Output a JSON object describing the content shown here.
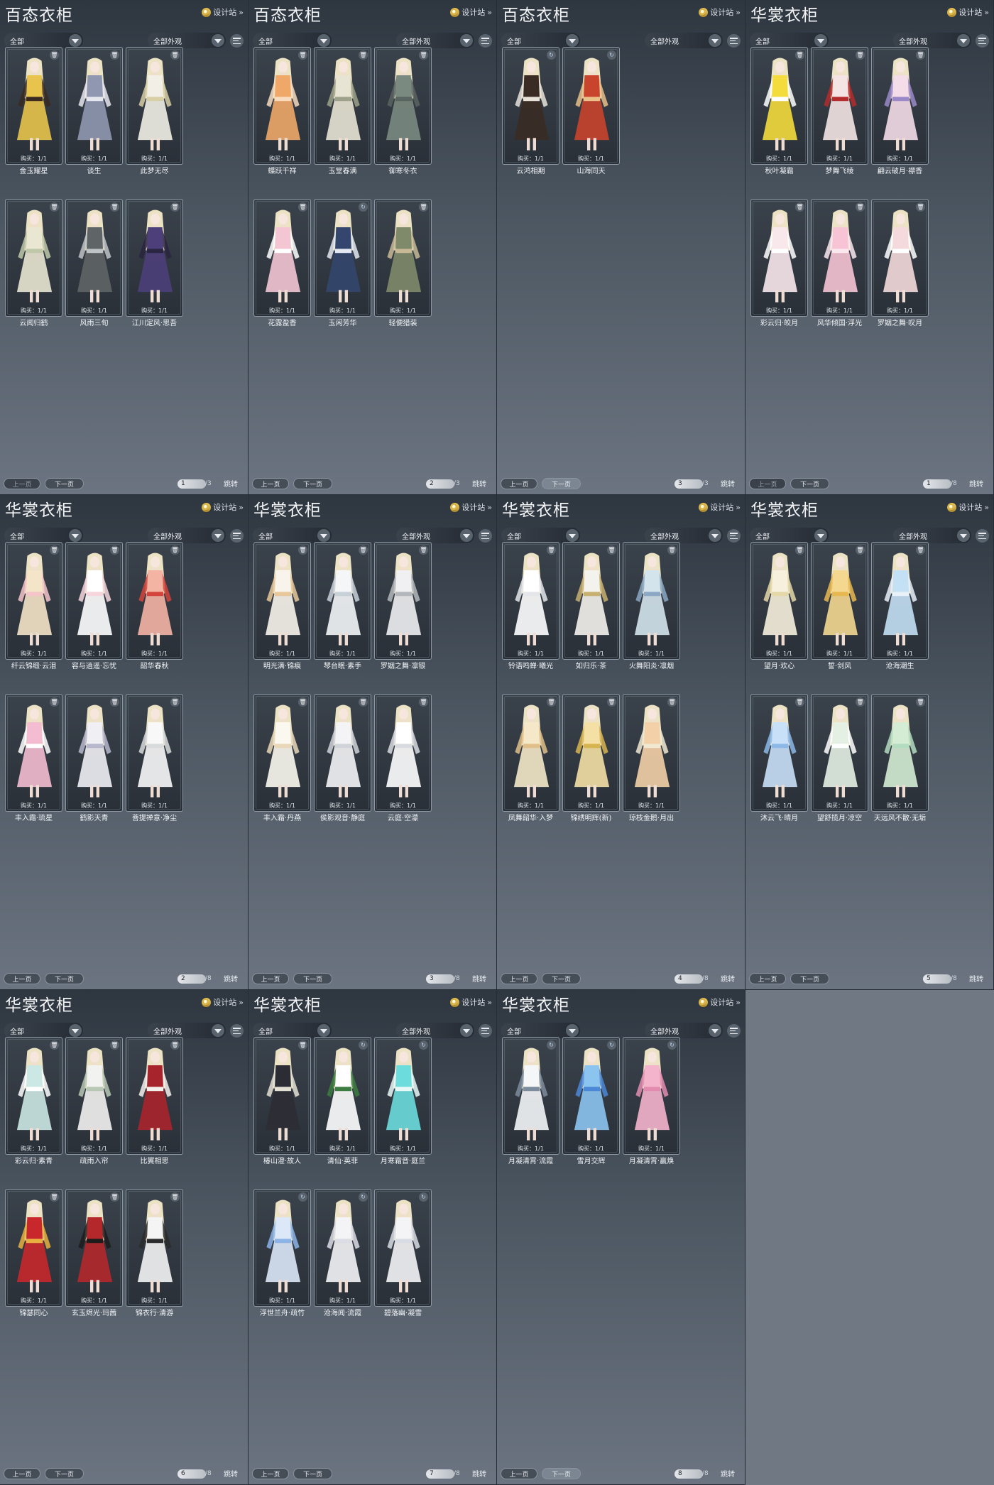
{
  "common": {
    "design_label": "设计站",
    "filter_left": "全部",
    "filter_right": "全部外观",
    "owned_label": "购买：1/1",
    "prev_label": "上一页",
    "next_label": "下一页",
    "jump_label": "跳转",
    "colors": {
      "panel_top": "#2e3640",
      "panel_bottom": "#6b7480",
      "card_border": "#8c98a4",
      "background": "#6f7883"
    }
  },
  "panels": [
    {
      "title": "百态衣柜",
      "page": "1",
      "total": "/3",
      "items": [
        {
          "name": "金玉耀星",
          "icon": "trash-icon",
          "palette": [
            "#e8c44c",
            "#3a2a22"
          ]
        },
        {
          "name": "谈生",
          "icon": "trash-icon",
          "palette": [
            "#8f98b0",
            "#e6e6ee"
          ]
        },
        {
          "name": "此梦无尽",
          "icon": "trash-icon",
          "palette": [
            "#f1efe6",
            "#d8cfa6"
          ]
        },
        {
          "name": "云闻归鹤",
          "icon": "trash-icon",
          "palette": [
            "#e9e6d2",
            "#bfc8a8"
          ]
        },
        {
          "name": "风雨三旬",
          "icon": "trash-icon",
          "palette": [
            "#5f6466",
            "#bfc3c6"
          ]
        },
        {
          "name": "江川定风·思吾",
          "icon": "trash-icon",
          "palette": [
            "#4c3f7a",
            "#2a2540"
          ]
        }
      ]
    },
    {
      "title": "百态衣柜",
      "page": "2",
      "total": "/3",
      "items": [
        {
          "name": "蝶跃千祥",
          "icon": "trash-icon",
          "palette": [
            "#f0a868",
            "#f8dcc0"
          ]
        },
        {
          "name": "玉堂春满",
          "icon": "trash-icon",
          "palette": [
            "#e8e4d4",
            "#9ea28a"
          ]
        },
        {
          "name": "御寒冬衣",
          "icon": "trash-icon",
          "palette": [
            "#7a8a80",
            "#5a6460"
          ]
        },
        {
          "name": "花露盈香",
          "icon": "trash-icon",
          "palette": [
            "#f4c6d4",
            "#ffffff"
          ]
        },
        {
          "name": "玉闲芳华",
          "icon": "refresh-icon",
          "palette": [
            "#34466e",
            "#e4e8f0"
          ]
        },
        {
          "name": "轻便猎装",
          "icon": "trash-icon",
          "palette": [
            "#7e8a6a",
            "#c8b896"
          ]
        }
      ]
    },
    {
      "title": "百态衣柜",
      "page": "3",
      "total": "/3",
      "items": [
        {
          "name": "云鸿相期",
          "icon": "refresh-icon",
          "palette": [
            "#3a2c24",
            "#e8e2da"
          ]
        },
        {
          "name": "山海同天",
          "icon": "refresh-icon",
          "palette": [
            "#c8442c",
            "#e8c088"
          ]
        }
      ]
    },
    {
      "title": "华裳衣柜",
      "page": "1",
      "total": "/8",
      "items": [
        {
          "name": "秋叶凝霜",
          "icon": "trash-icon",
          "palette": [
            "#f4dc3c",
            "#ffffff"
          ]
        },
        {
          "name": "梦舞飞绫",
          "icon": "trash-icon",
          "palette": [
            "#f4e4e4",
            "#b42c2c"
          ]
        },
        {
          "name": "翩云破月·襟香",
          "icon": "trash-icon",
          "palette": [
            "#f4dde8",
            "#9a88c8"
          ]
        },
        {
          "name": "彩云归·皎月",
          "icon": "trash-icon",
          "palette": [
            "#f8e8ec",
            "#ffffff"
          ]
        },
        {
          "name": "风华倾国·浮光",
          "icon": "trash-icon",
          "palette": [
            "#f6c4d4",
            "#fbe8ee"
          ]
        },
        {
          "name": "罗姻之舞·叹月",
          "icon": "trash-icon",
          "palette": [
            "#f4dadc",
            "#ffffff"
          ]
        }
      ]
    },
    {
      "title": "华裳衣柜",
      "page": "2",
      "total": "/8",
      "items": [
        {
          "name": "纤云锦缎·云泪",
          "icon": "trash-icon",
          "palette": [
            "#f4e4c8",
            "#f4c4c8"
          ]
        },
        {
          "name": "容与逍遥·忘忧",
          "icon": "trash-icon",
          "palette": [
            "#ffffff",
            "#f6d6dc"
          ]
        },
        {
          "name": "韶华春秋",
          "icon": "trash-icon",
          "palette": [
            "#f4b4a4",
            "#d4443c"
          ]
        },
        {
          "name": "丰入霜·琉星",
          "icon": "trash-icon",
          "palette": [
            "#f4bcd0",
            "#ffffff"
          ]
        },
        {
          "name": "鹤影天青",
          "icon": "trash-icon",
          "palette": [
            "#f0f0f4",
            "#b8b8cc"
          ]
        },
        {
          "name": "菩提禅意·净尘",
          "icon": "trash-icon",
          "palette": [
            "#f8f8f8",
            "#d8dcdc"
          ]
        }
      ]
    },
    {
      "title": "华裳衣柜",
      "page": "3",
      "total": "/8",
      "items": [
        {
          "name": "明光满·锦痕",
          "icon": "trash-icon",
          "palette": [
            "#f8f4ec",
            "#e8c89a"
          ]
        },
        {
          "name": "琴台眠·素手",
          "icon": "trash-icon",
          "palette": [
            "#f4f6f8",
            "#c8d0d8"
          ]
        },
        {
          "name": "罗姻之舞·凛银",
          "icon": "trash-icon",
          "palette": [
            "#f0f0f2",
            "#b4b8bc"
          ]
        },
        {
          "name": "丰入霜·丹燕",
          "icon": "trash-icon",
          "palette": [
            "#fbf8f0",
            "#e8d8b8"
          ]
        },
        {
          "name": "侯影观音·静庭",
          "icon": "trash-icon",
          "palette": [
            "#f4f4f6",
            "#d0d4d8"
          ]
        },
        {
          "name": "云庭·空濛",
          "icon": "trash-icon",
          "palette": [
            "#ffffff",
            "#d8dce0"
          ]
        }
      ]
    },
    {
      "title": "华裳衣柜",
      "page": "4",
      "total": "/8",
      "items": [
        {
          "name": "铃语鸣蝉·曦光",
          "icon": "trash-icon",
          "palette": [
            "#ffffff",
            "#e4e6ea"
          ]
        },
        {
          "name": "如归乐·茶",
          "icon": "trash-icon",
          "palette": [
            "#f4f2ec",
            "#c8b070"
          ]
        },
        {
          "name": "火舞阳炎·凛烟",
          "icon": "trash-icon",
          "palette": [
            "#d4e4ec",
            "#8ca8c4"
          ]
        },
        {
          "name": "凤舞韶华·入梦",
          "icon": "trash-icon",
          "palette": [
            "#f4e8c8",
            "#e0c088"
          ]
        },
        {
          "name": "锦绣明辉(新)",
          "icon": "trash-icon",
          "palette": [
            "#f4e0a4",
            "#d8b450"
          ]
        },
        {
          "name": "琼枝金鹅·月出",
          "icon": "trash-icon",
          "palette": [
            "#f4d0a8",
            "#f0e8d0"
          ]
        }
      ]
    },
    {
      "title": "华裳衣柜",
      "page": "5",
      "total": "/8",
      "items": [
        {
          "name": "望月·欢心",
          "icon": "trash-icon",
          "palette": [
            "#f6f0dc",
            "#e4d8a8"
          ]
        },
        {
          "name": "誓·剑风",
          "icon": "trash-icon",
          "palette": [
            "#f4d890",
            "#e8b850"
          ]
        },
        {
          "name": "沧海潮生",
          "icon": "trash-icon",
          "palette": [
            "#c4e0f4",
            "#e8f0f8"
          ]
        },
        {
          "name": "沐云飞·晴月",
          "icon": "trash-icon",
          "palette": [
            "#c8e0f8",
            "#8cb8e8"
          ]
        },
        {
          "name": "望舒揽月·凉空",
          "icon": "trash-icon",
          "palette": [
            "#e4f0e4",
            "#ffffff"
          ]
        },
        {
          "name": "天远风不散·无垢",
          "icon": "trash-icon",
          "palette": [
            "#d4ecd4",
            "#b4dcc0"
          ]
        }
      ]
    },
    {
      "title": "华裳衣柜",
      "page": "6",
      "total": "/8",
      "items": [
        {
          "name": "彩云归·素青",
          "icon": "trash-icon",
          "palette": [
            "#cce8e4",
            "#ffffff"
          ]
        },
        {
          "name": "疏雨入帘",
          "icon": "trash-icon",
          "palette": [
            "#f2f2f0",
            "#b8c8b4"
          ]
        },
        {
          "name": "比翼相思",
          "icon": "trash-icon",
          "palette": [
            "#a8242c",
            "#f4f0ec"
          ]
        },
        {
          "name": "锦瑟同心",
          "icon": "trash-icon",
          "palette": [
            "#c8282c",
            "#e8b040"
          ]
        },
        {
          "name": "玄玉烬光·玛茜",
          "icon": "trash-icon",
          "palette": [
            "#b4282c",
            "#1c1c1c"
          ]
        },
        {
          "name": "锦衣行·清游",
          "icon": "trash-icon",
          "palette": [
            "#f4f4f4",
            "#2c2c2c"
          ]
        }
      ]
    },
    {
      "title": "华裳衣柜",
      "page": "7",
      "total": "/8",
      "items": [
        {
          "name": "椿山澄·故人",
          "icon": "trash-icon",
          "palette": [
            "#2c2c34",
            "#e4e0d4"
          ]
        },
        {
          "name": "清仙·英菲",
          "icon": "refresh-icon",
          "palette": [
            "#ffffff",
            "#3c7c40"
          ]
        },
        {
          "name": "月寒霜音·庭兰",
          "icon": "refresh-icon",
          "palette": [
            "#6cdcdc",
            "#e8f8f8"
          ]
        },
        {
          "name": "浮世兰舟·疏竹",
          "icon": "refresh-icon",
          "palette": [
            "#dce8f8",
            "#8cb4e8"
          ]
        },
        {
          "name": "沧海闻·流霞",
          "icon": "refresh-icon",
          "palette": [
            "#f4f4f6",
            "#dcdce4"
          ]
        },
        {
          "name": "碧落幽·凝雪",
          "icon": "refresh-icon",
          "palette": [
            "#f4f4f6",
            "#d8dce4"
          ]
        }
      ]
    },
    {
      "title": "华裳衣柜",
      "page": "8",
      "total": "/8",
      "items": [
        {
          "name": "月凝清霄·流霞",
          "icon": "refresh-icon",
          "palette": [
            "#f4f6f8",
            "#7c8c9c"
          ]
        },
        {
          "name": "雪月交辉",
          "icon": "refresh-icon",
          "palette": [
            "#8cc4f0",
            "#4c88d8"
          ]
        },
        {
          "name": "月凝清霄·赢焕",
          "icon": "refresh-icon",
          "palette": [
            "#f4b4cc",
            "#e48cb0"
          ]
        }
      ]
    }
  ]
}
